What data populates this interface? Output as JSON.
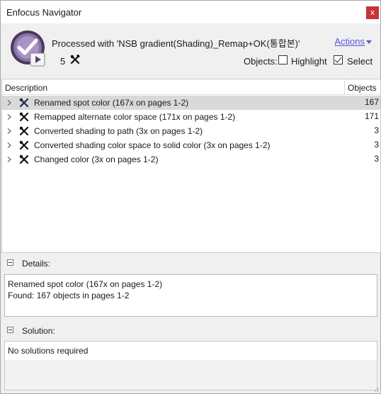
{
  "window": {
    "title": "Enfocus Navigator",
    "close_label": "x"
  },
  "header": {
    "processed_text": "Processed with 'NSB gradient(Shading)_Remap+OK(통합본)'",
    "actions_label": "Actions",
    "fix_count": "5",
    "objects_label": "Objects:",
    "highlight_label": "Highlight",
    "highlight_checked": false,
    "select_label": "Select",
    "select_checked": true
  },
  "list": {
    "columns": {
      "description": "Description",
      "objects": "Objects"
    },
    "rows": [
      {
        "label": "Renamed spot color (167x on pages 1-2)",
        "count": "167",
        "selected": true
      },
      {
        "label": "Remapped alternate color space (171x on pages 1-2)",
        "count": "171",
        "selected": false
      },
      {
        "label": "Converted shading to path (3x on pages 1-2)",
        "count": "3",
        "selected": false
      },
      {
        "label": "Converted shading color space to solid color (3x on pages 1-2)",
        "count": "3",
        "selected": false
      },
      {
        "label": "Changed color (3x on pages 1-2)",
        "count": "3",
        "selected": false
      }
    ]
  },
  "details": {
    "label": "Details:",
    "line1": "Renamed spot color (167x on pages 1-2)",
    "line2": "Found: 167 objects in pages 1-2"
  },
  "solution": {
    "label": "Solution:",
    "text": "No solutions required"
  },
  "colors": {
    "accent_link": "#5a55d6",
    "close_red": "#c8323a",
    "selected_row": "#d9d9d9",
    "logo_purple": "#7a5c9e"
  }
}
